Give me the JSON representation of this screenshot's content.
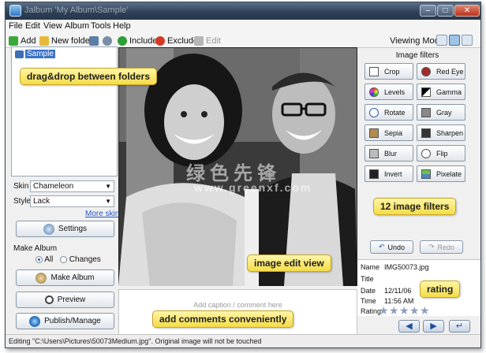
{
  "window": {
    "title": "Jalbum 'My Album\\Sample'",
    "controls": [
      "–",
      "□",
      "✕"
    ]
  },
  "menu": [
    "File",
    "Edit",
    "View",
    "Album",
    "Tools",
    "Help"
  ],
  "toolbar": {
    "add": "Add",
    "new_folder": "New folder",
    "include": "Include",
    "exclude": "Exclude",
    "edit": "Edit",
    "viewing_mode": "Viewing Mode:"
  },
  "tree": {
    "root": "Sample"
  },
  "settings": {
    "skin_label": "Skin",
    "skin_value": "Chameleon",
    "style_label": "Style",
    "style_value": "Lack",
    "more_skins": "More skins",
    "settings_button": "Settings",
    "make_album_group": "Make Album",
    "radio_all": "All",
    "radio_changes": "Changes",
    "make_album_button": "Make Album",
    "preview_button": "Preview",
    "publish_button": "Publish/Manage"
  },
  "filters": {
    "title": "Image filters",
    "buttons": [
      {
        "label": "Crop"
      },
      {
        "label": "Red Eye"
      },
      {
        "label": "Levels"
      },
      {
        "label": "Gamma"
      },
      {
        "label": "Rotate"
      },
      {
        "label": "Gray"
      },
      {
        "label": "Sepia"
      },
      {
        "label": "Sharpen"
      },
      {
        "label": "Blur"
      },
      {
        "label": "Flip"
      },
      {
        "label": "Invert"
      },
      {
        "label": "Pixelate"
      }
    ],
    "undo": "Undo",
    "redo": "Redo"
  },
  "image_info": {
    "name_label": "Name",
    "name_value": "IMG50073.jpg",
    "title_label": "Title",
    "date_label": "Date",
    "date_value": "12/11/06",
    "time_label": "Time",
    "time_value": "11:56 AM",
    "rating_label": "Rating",
    "rating_value": 0
  },
  "caption": {
    "placeholder": "Add caption / comment here"
  },
  "nav": [
    "◀",
    "▶",
    "↵"
  ],
  "status": "Editing \"C:\\Users\\Pictures\\50073Medium.jpg\". Original image will not be touched",
  "annotations": {
    "drag_drop": "drag&drop between folders",
    "filters": "12 image filters",
    "edit_view": "image edit view",
    "rating": "rating",
    "comments": "add comments conveniently"
  },
  "watermark": {
    "main": "绿色先锋",
    "url": "www.greenxf.com"
  },
  "colors": {
    "accent": "#3a73c8",
    "callout": "#f4dc48",
    "titlebar": "#2e3f55"
  }
}
